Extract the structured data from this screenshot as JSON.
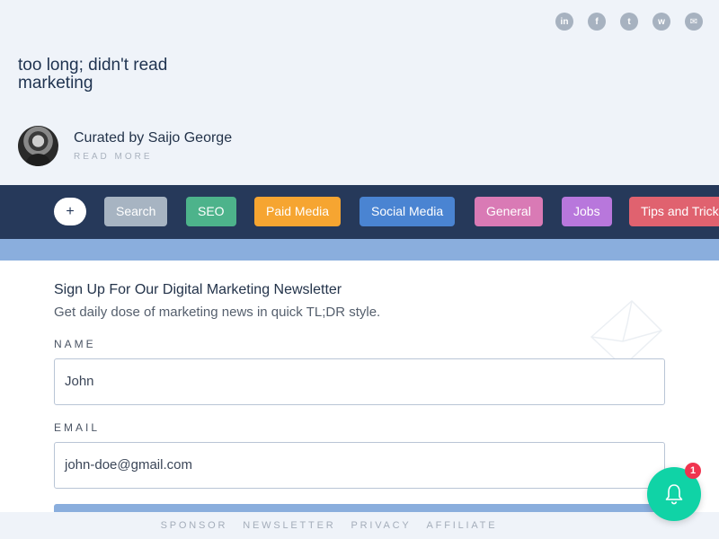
{
  "header": {
    "social": [
      {
        "icon": "linkedin-icon",
        "glyph": "in"
      },
      {
        "icon": "facebook-icon",
        "glyph": "f"
      },
      {
        "icon": "twitter-icon",
        "glyph": "t"
      },
      {
        "icon": "whatsapp-icon",
        "glyph": "w"
      },
      {
        "icon": "email-icon",
        "glyph": "✉"
      }
    ],
    "site_title": "too long; didn't read marketing",
    "curator": "Curated by Saijo George",
    "read_more": "READ MORE"
  },
  "categories": {
    "plus_label": "+",
    "items": [
      {
        "label": "Search",
        "color": "#a7b4c2"
      },
      {
        "label": "SEO",
        "color": "#4db38b"
      },
      {
        "label": "Paid Media",
        "color": "#f6a531"
      },
      {
        "label": "Social Media",
        "color": "#4a84d2"
      },
      {
        "label": "General",
        "color": "#d97ab5"
      },
      {
        "label": "Jobs",
        "color": "#b877dc"
      },
      {
        "label": "Tips and Tricks",
        "color": "#e0626f"
      }
    ]
  },
  "newsletter": {
    "title": "Sign Up For Our Digital Marketing Newsletter",
    "subtitle": "Get daily dose of marketing news in quick TL;DR style.",
    "name_label": "NAME",
    "name_value": "John",
    "email_label": "EMAIL",
    "email_value": "john-doe@gmail.com"
  },
  "footer": {
    "links": [
      "SPONSOR",
      "NEWSLETTER",
      "PRIVACY",
      "AFFILIATE"
    ]
  },
  "notifications": {
    "count": "1",
    "accent": "#10d3a6"
  }
}
